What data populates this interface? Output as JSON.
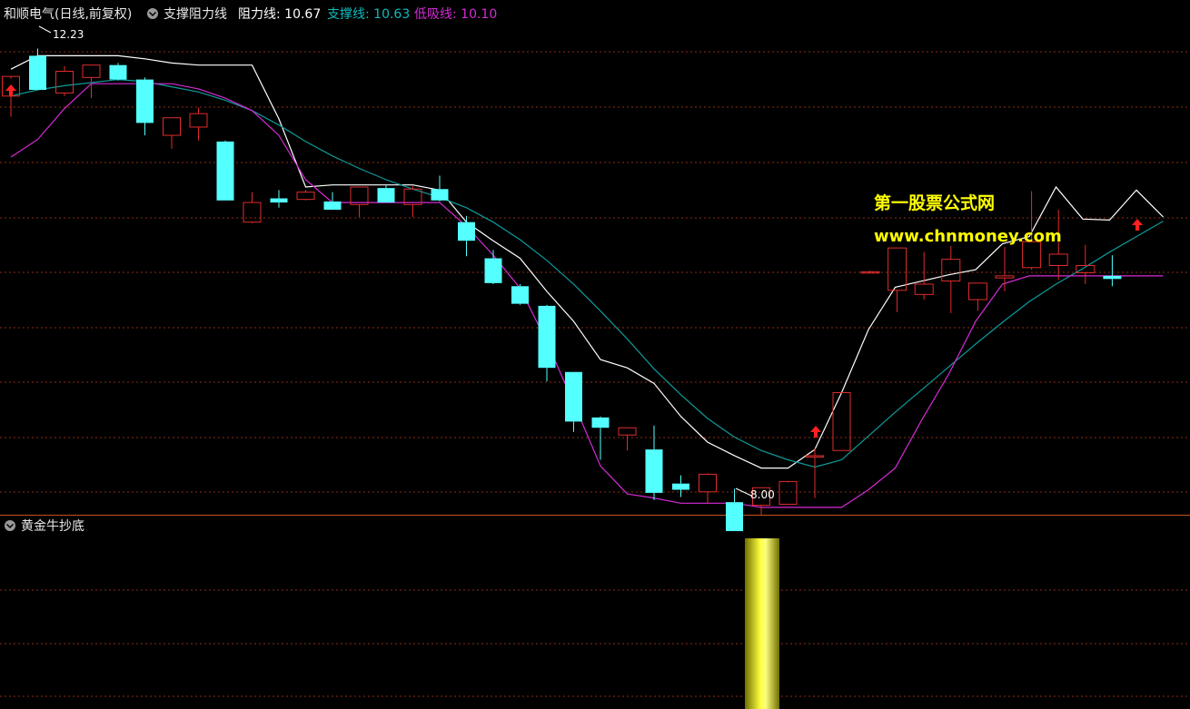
{
  "colors": {
    "background": "#000000",
    "grid": "#8b2e12",
    "separator": "#c8501e",
    "up": "#e02c2c",
    "down": "#54ffff",
    "resistance": "#ffffff",
    "support": "#0f9a9a",
    "lowbuy": "#d62bd6",
    "watermark": "#ffff00",
    "arrow": "#ff2020",
    "volume_bar": "#d8d800"
  },
  "header": {
    "title": "和顺电气(日线,前复权)",
    "indicator_name": "支撑阻力线",
    "resist_label": "阻力线: 10.67",
    "support_label": "支撑线: 10.63",
    "lowbuy_label": "低吸线: 10.10"
  },
  "watermark": {
    "line1": "第一股票公式网",
    "line2": "www.chnmoney.com"
  },
  "annotations": {
    "high_label": "12.23",
    "low_label": "8.00"
  },
  "lower_panel": {
    "title": "黄金牛抄底"
  },
  "chart_data": {
    "type": "candlestick",
    "title": "和顺电气(日线,前复权)",
    "ylim": [
      7.85,
      12.55
    ],
    "candles": [
      {
        "o": 11.84,
        "h": 12.01,
        "l": 11.64,
        "c": 12.03
      },
      {
        "o": 12.23,
        "h": 12.3,
        "l": 11.91,
        "c": 11.9
      },
      {
        "o": 11.87,
        "h": 12.13,
        "l": 11.84,
        "c": 12.08
      },
      {
        "o": 12.02,
        "h": 12.14,
        "l": 11.82,
        "c": 12.14
      },
      {
        "o": 12.14,
        "h": 12.16,
        "l": 11.99,
        "c": 12.0
      },
      {
        "o": 12.0,
        "h": 12.02,
        "l": 11.46,
        "c": 11.58
      },
      {
        "o": 11.46,
        "h": 11.63,
        "l": 11.33,
        "c": 11.63
      },
      {
        "o": 11.54,
        "h": 11.73,
        "l": 11.41,
        "c": 11.67
      },
      {
        "o": 11.4,
        "h": 11.41,
        "l": 10.83,
        "c": 10.83
      },
      {
        "o": 10.62,
        "h": 10.91,
        "l": 10.61,
        "c": 10.81
      },
      {
        "o": 10.85,
        "h": 10.93,
        "l": 10.76,
        "c": 10.81
      },
      {
        "o": 10.84,
        "h": 10.93,
        "l": 10.83,
        "c": 10.91
      },
      {
        "o": 10.82,
        "h": 10.91,
        "l": 10.76,
        "c": 10.74
      },
      {
        "o": 10.79,
        "h": 10.96,
        "l": 10.67,
        "c": 10.96
      },
      {
        "o": 10.95,
        "h": 10.98,
        "l": 10.81,
        "c": 10.81
      },
      {
        "o": 10.79,
        "h": 10.97,
        "l": 10.67,
        "c": 10.94
      },
      {
        "o": 10.94,
        "h": 11.07,
        "l": 10.82,
        "c": 10.83
      },
      {
        "o": 10.62,
        "h": 10.68,
        "l": 10.29,
        "c": 10.44
      },
      {
        "o": 10.27,
        "h": 10.35,
        "l": 10.02,
        "c": 10.03
      },
      {
        "o": 10.0,
        "h": 10.02,
        "l": 9.82,
        "c": 9.83
      },
      {
        "o": 9.81,
        "h": 9.82,
        "l": 9.08,
        "c": 9.21
      },
      {
        "o": 9.17,
        "h": 9.17,
        "l": 8.59,
        "c": 8.69
      },
      {
        "o": 8.73,
        "h": 8.74,
        "l": 8.32,
        "c": 8.63
      },
      {
        "o": 8.56,
        "h": 8.63,
        "l": 8.41,
        "c": 8.63
      },
      {
        "o": 8.42,
        "h": 8.65,
        "l": 7.93,
        "c": 8.0
      },
      {
        "o": 8.09,
        "h": 8.17,
        "l": 7.96,
        "c": 8.03
      },
      {
        "o": 8.01,
        "h": 8.19,
        "l": 7.9,
        "c": 8.18
      },
      {
        "o": 7.91,
        "h": 8.04,
        "l": 7.83,
        "c": 7.63
      },
      {
        "o": 7.88,
        "h": 8.05,
        "l": 7.79,
        "c": 8.05
      },
      {
        "o": 7.89,
        "h": 8.1,
        "l": 7.89,
        "c": 8.11
      },
      {
        "o": 8.35,
        "h": 8.43,
        "l": 7.95,
        "c": 8.36
      },
      {
        "o": 8.41,
        "h": 8.97,
        "l": 8.41,
        "c": 8.97
      }
    ],
    "wide_candles": [
      {
        "o": 10.13,
        "h": 10.15,
        "l": 10.14,
        "c": 10.14
      },
      {
        "o": 9.96,
        "h": 10.37,
        "l": 9.75,
        "c": 10.37
      },
      {
        "o": 9.92,
        "h": 10.33,
        "l": 9.87,
        "c": 10.02
      },
      {
        "o": 10.05,
        "h": 10.39,
        "l": 9.74,
        "c": 10.26
      },
      {
        "o": 9.87,
        "h": 10.03,
        "l": 9.76,
        "c": 10.03
      },
      {
        "o": 10.08,
        "h": 10.38,
        "l": 9.95,
        "c": 10.1
      },
      {
        "o": 10.18,
        "h": 10.92,
        "l": 10.16,
        "c": 10.43
      },
      {
        "o": 10.2,
        "h": 10.74,
        "l": 10.06,
        "c": 10.31
      },
      {
        "o": 10.13,
        "h": 10.4,
        "l": 10.02,
        "c": 10.2
      },
      {
        "o": 10.1,
        "h": 10.3,
        "l": 10.0,
        "c": 10.07
      }
    ],
    "series": [
      {
        "name": "阻力线",
        "values": [
          12.1,
          12.23,
          12.23,
          12.23,
          12.23,
          12.2,
          12.16,
          12.14,
          12.14,
          12.14,
          11.62,
          10.96,
          10.98,
          10.98,
          10.98,
          10.98,
          10.93,
          10.62,
          10.44,
          10.27,
          9.95,
          9.66,
          9.29,
          9.21,
          9.06,
          8.74,
          8.49,
          8.36,
          8.24,
          8.24,
          8.42,
          8.97,
          9.58,
          9.99,
          10.05,
          10.11,
          10.16,
          10.41,
          10.48,
          10.96,
          10.65,
          10.64,
          10.93,
          10.67
        ]
      },
      {
        "name": "支撑线",
        "values": [
          11.84,
          11.9,
          11.94,
          11.97,
          12.0,
          11.98,
          11.93,
          11.88,
          11.8,
          11.7,
          11.56,
          11.4,
          11.26,
          11.14,
          11.03,
          10.94,
          10.86,
          10.76,
          10.62,
          10.45,
          10.25,
          10.02,
          9.76,
          9.49,
          9.2,
          8.95,
          8.72,
          8.54,
          8.41,
          8.32,
          8.25,
          8.32,
          8.55,
          8.78,
          9.0,
          9.22,
          9.44,
          9.65,
          9.85,
          10.02,
          10.17,
          10.33,
          10.48,
          10.63
        ]
      },
      {
        "name": "低吸线",
        "values": [
          11.25,
          11.42,
          11.72,
          11.96,
          11.96,
          11.96,
          11.96,
          11.91,
          11.82,
          11.7,
          11.46,
          11.03,
          10.81,
          10.81,
          10.81,
          10.81,
          10.81,
          10.58,
          10.3,
          9.98,
          9.46,
          8.87,
          8.26,
          7.99,
          7.95,
          7.9,
          7.9,
          7.9,
          7.86,
          7.86,
          7.86,
          7.86,
          8.03,
          8.24,
          8.71,
          9.15,
          9.66,
          10.02,
          10.1,
          10.1,
          10.1,
          10.1,
          10.1,
          10.1
        ]
      }
    ],
    "lower_bar": {
      "index": 28,
      "height_fraction": 0.82
    }
  }
}
